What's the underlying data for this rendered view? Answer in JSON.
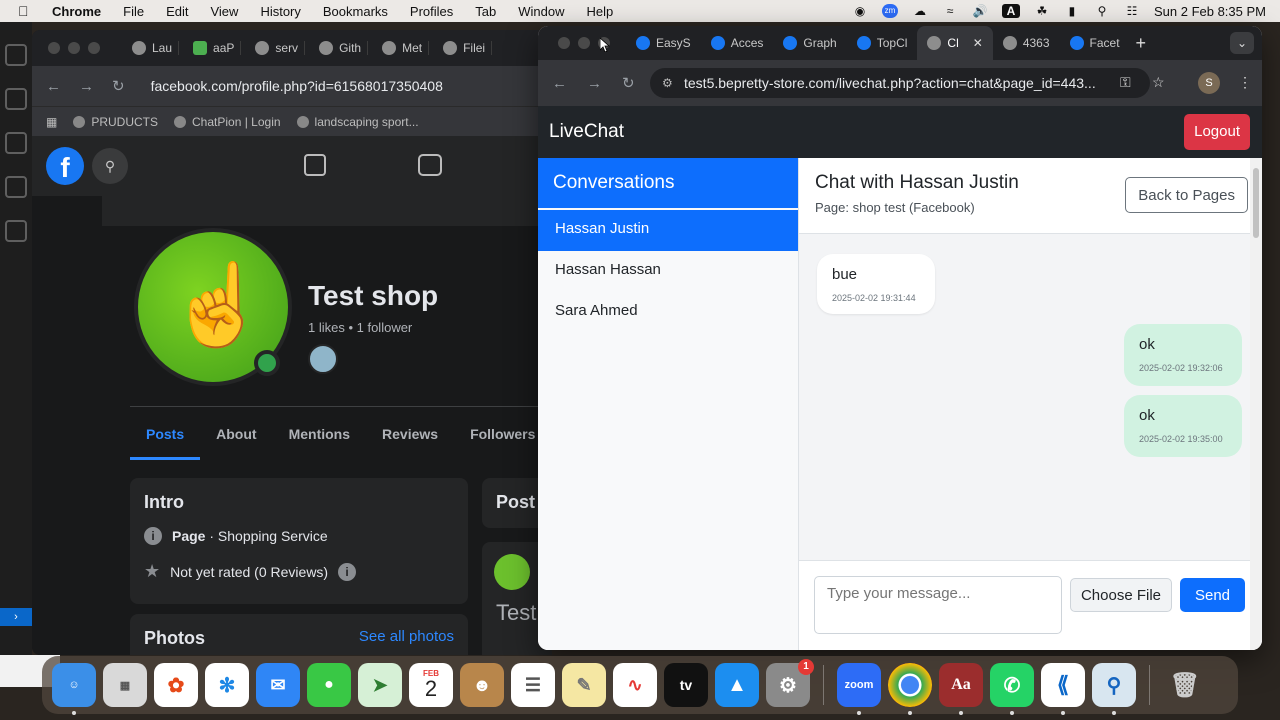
{
  "menubar": {
    "app": "Chrome",
    "items": [
      "File",
      "Edit",
      "View",
      "History",
      "Bookmarks",
      "Profiles",
      "Tab",
      "Window",
      "Help"
    ],
    "datetime": "Sun 2 Feb  8:35 PM",
    "input_indicator": "A"
  },
  "fb_window": {
    "tabs": [
      "Lau",
      "aaP",
      "serv",
      "Gith",
      "Met",
      "Filei"
    ],
    "url": "facebook.com/profile.php?id=61568017350408",
    "bookmarks": [
      "PRUDUCTS",
      "ChatPion | Login",
      "landscaping sport..."
    ],
    "page_name": "Test shop",
    "stats": "1 likes • 1 follower",
    "nav_tabs": [
      "Posts",
      "About",
      "Mentions",
      "Reviews",
      "Followers"
    ],
    "intro_title": "Intro",
    "intro_page_label": "Page",
    "intro_category": " · Shopping Service",
    "intro_rating": "Not yet rated (0 Reviews)",
    "posts_title": "Post",
    "post_preview": "Test",
    "photos_title": "Photos",
    "see_all_photos": "See all photos"
  },
  "chrome_window": {
    "tabs": [
      "EasyS",
      "Acces",
      "Graph",
      "TopCl",
      "Cl",
      "4363",
      "Facet"
    ],
    "url": "test5.bepretty-store.com/livechat.php?action=chat&page_id=443...",
    "profile_initial": "S"
  },
  "livechat": {
    "brand": "LiveChat",
    "logout": "Logout",
    "sidebar_title": "Conversations",
    "conversations": [
      "Hassan Justin",
      "Hassan Hassan",
      "Sara Ahmed"
    ],
    "chat_title": "Chat with Hassan Justin",
    "chat_subtitle": "Page: shop test (Facebook)",
    "back_button": "Back to Pages",
    "messages": [
      {
        "direction": "in",
        "text": "bue",
        "time": "2025-02-02 19:31:44"
      },
      {
        "direction": "out",
        "text": "ok",
        "time": "2025-02-02 19:32:06"
      },
      {
        "direction": "out",
        "text": "ok",
        "time": "2025-02-02 19:35:00"
      }
    ],
    "input_placeholder": "Type your message...",
    "choose_file": "Choose File",
    "send": "Send"
  },
  "dock": {
    "calendar_month": "FEB",
    "calendar_day": "2",
    "appletv_label": "tv",
    "zoom_label": "zoom",
    "dictionary_label": "Aa",
    "settings_badge": "1"
  }
}
